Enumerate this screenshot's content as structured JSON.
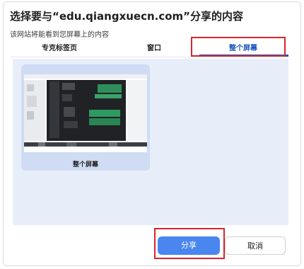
{
  "dialog": {
    "title": "选择要与“edu.qiangxuecn.com”分享的内容",
    "subtitle": "该网站将能看到您屏幕上的内容"
  },
  "tabs": [
    {
      "label": "专克标签页",
      "selected": false
    },
    {
      "label": "窗口",
      "selected": false
    },
    {
      "label": "整个屏幕",
      "selected": true
    }
  ],
  "screens": [
    {
      "label": "整个屏幕"
    }
  ],
  "buttons": {
    "share": "分享",
    "cancel": "取消"
  },
  "colors": {
    "accent": "#1a56c4",
    "primary_button": "#4a86f0",
    "highlight": "#d6262c",
    "panel_bg": "#e8eef9",
    "card_bg": "#cfdcf4"
  }
}
